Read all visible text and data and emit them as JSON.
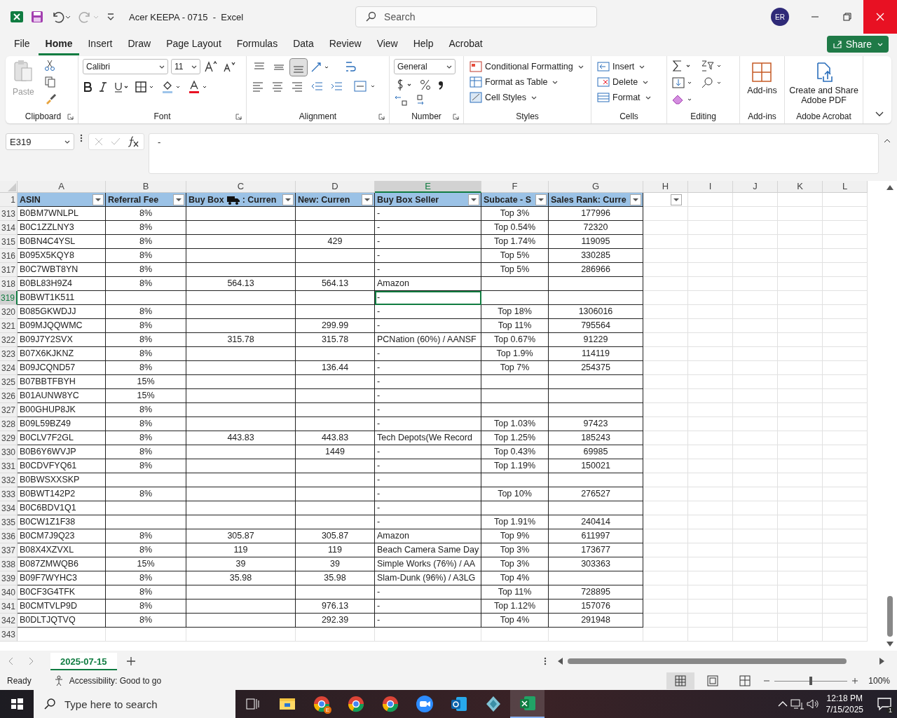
{
  "title_bar": {
    "title": "Acer KEEPA - 0715  -  Excel",
    "search_placeholder": "Search",
    "avatar_initials": "ER"
  },
  "menu_tabs": [
    {
      "label": "File",
      "selected": false
    },
    {
      "label": "Home",
      "selected": true
    },
    {
      "label": "Insert",
      "selected": false
    },
    {
      "label": "Draw",
      "selected": false
    },
    {
      "label": "Page Layout",
      "selected": false
    },
    {
      "label": "Formulas",
      "selected": false
    },
    {
      "label": "Data",
      "selected": false
    },
    {
      "label": "Review",
      "selected": false
    },
    {
      "label": "View",
      "selected": false
    },
    {
      "label": "Help",
      "selected": false
    },
    {
      "label": "Acrobat",
      "selected": false
    }
  ],
  "share_button": "Share",
  "ribbon": {
    "paste_label": "Paste",
    "font_name": "Calibri",
    "font_size": "11",
    "number_format": "General",
    "vertical_align": [
      {
        "kind": "top",
        "selected": false
      },
      {
        "kind": "middle",
        "selected": false
      },
      {
        "kind": "bottom",
        "selected": true
      }
    ],
    "styles": [
      {
        "kind": "conditional",
        "label": "Conditional Formatting"
      },
      {
        "kind": "table",
        "label": "Format as Table"
      },
      {
        "kind": "cellstyles",
        "label": "Cell Styles"
      }
    ],
    "cells": [
      {
        "kind": "insert",
        "label": "Insert"
      },
      {
        "kind": "delete",
        "label": "Delete"
      },
      {
        "kind": "format",
        "label": "Format"
      }
    ],
    "addins_button": "Add-ins",
    "adobe_button": "Create and Share Adobe PDF",
    "group_labels": [
      "Clipboard",
      "Font",
      "Alignment",
      "Number",
      "Styles",
      "Cells",
      "Editing",
      "Add-ins",
      "Adobe Acrobat"
    ]
  },
  "formula_bar": {
    "name_box": "E319",
    "formula": "-"
  },
  "columns": [
    {
      "letter": "A",
      "header": "ASIN",
      "selected": false
    },
    {
      "letter": "B",
      "header": "Referral Fee",
      "selected": false
    },
    {
      "letter": "C",
      "header": "Buy Box",
      "header_suffix": ": Curren",
      "selected": false
    },
    {
      "letter": "D",
      "header": "New: Curren",
      "selected": false
    },
    {
      "letter": "E",
      "header": "Buy Box Seller",
      "selected": true
    },
    {
      "letter": "F",
      "header": "Subcate - S",
      "selected": false
    },
    {
      "letter": "G",
      "header": "Sales Rank: Curre",
      "selected": false
    }
  ],
  "extra_columns": [
    {
      "letter": "H",
      "filter_button": true
    },
    {
      "letter": "I",
      "filter_button": false
    },
    {
      "letter": "J",
      "filter_button": false
    },
    {
      "letter": "K",
      "filter_button": false
    },
    {
      "letter": "L",
      "filter_button": false
    }
  ],
  "header_row": "1",
  "rows": [
    {
      "row": "313",
      "asin": "B0BM7WNLPL",
      "fee": "8%",
      "seller": "-",
      "subcat": "Top 3%",
      "rank": "177996",
      "selected": false
    },
    {
      "row": "314",
      "asin": "B0C1ZZLNY3",
      "fee": "8%",
      "seller": "-",
      "subcat": "Top 0.54%",
      "rank": "72320",
      "selected": false
    },
    {
      "row": "315",
      "asin": "B0BN4C4YSL",
      "fee": "8%",
      "new": "429",
      "seller": "-",
      "subcat": "Top 1.74%",
      "rank": "119095",
      "selected": false
    },
    {
      "row": "316",
      "asin": "B095X5KQY8",
      "fee": "8%",
      "seller": "-",
      "subcat": "Top 5%",
      "rank": "330285",
      "selected": false
    },
    {
      "row": "317",
      "asin": "B0C7WBT8YN",
      "fee": "8%",
      "seller": "-",
      "subcat": "Top 5%",
      "rank": "286966",
      "selected": false
    },
    {
      "row": "318",
      "asin": "B0BL83H9Z4",
      "fee": "8%",
      "buybox": "564.13",
      "new": "564.13",
      "seller": "Amazon",
      "selected": false
    },
    {
      "row": "319",
      "asin": "B0BWT1K511",
      "seller": "-",
      "selected": true
    },
    {
      "row": "320",
      "asin": "B085GKWDJJ",
      "fee": "8%",
      "seller": "-",
      "subcat": "Top 18%",
      "rank": "1306016",
      "selected": false
    },
    {
      "row": "321",
      "asin": "B09MJQQWMC",
      "fee": "8%",
      "new": "299.99",
      "seller": "-",
      "subcat": "Top 11%",
      "rank": "795564",
      "selected": false
    },
    {
      "row": "322",
      "asin": "B09J7Y2SVX",
      "fee": "8%",
      "buybox": "315.78",
      "new": "315.78",
      "seller": "PCNation (60%) / AANSF",
      "subcat": "Top 0.67%",
      "rank": "91229",
      "selected": false
    },
    {
      "row": "323",
      "asin": "B07X6KJKNZ",
      "fee": "8%",
      "seller": "-",
      "subcat": "Top 1.9%",
      "rank": "114119",
      "selected": false
    },
    {
      "row": "324",
      "asin": "B09JCQND57",
      "fee": "8%",
      "new": "136.44",
      "seller": "-",
      "subcat": "Top 7%",
      "rank": "254375",
      "selected": false
    },
    {
      "row": "325",
      "asin": "B07BBTFBYH",
      "fee": "15%",
      "seller": "-",
      "selected": false
    },
    {
      "row": "326",
      "asin": "B01AUNW8YC",
      "fee": "15%",
      "seller": "-",
      "selected": false
    },
    {
      "row": "327",
      "asin": "B00GHUP8JK",
      "fee": "8%",
      "seller": "-",
      "selected": false
    },
    {
      "row": "328",
      "asin": "B09L59BZ49",
      "fee": "8%",
      "seller": "-",
      "subcat": "Top 1.03%",
      "rank": "97423",
      "selected": false
    },
    {
      "row": "329",
      "asin": "B0CLV7F2GL",
      "fee": "8%",
      "buybox": "443.83",
      "new": "443.83",
      "seller": "Tech Depots(We Record",
      "subcat": "Top 1.25%",
      "rank": "185243",
      "selected": false
    },
    {
      "row": "330",
      "asin": "B0B6Y6WVJP",
      "fee": "8%",
      "new": "1449",
      "seller": "-",
      "subcat": "Top 0.43%",
      "rank": "69985",
      "selected": false
    },
    {
      "row": "331",
      "asin": "B0CDVFYQ61",
      "fee": "8%",
      "seller": "-",
      "subcat": "Top 1.19%",
      "rank": "150021",
      "selected": false
    },
    {
      "row": "332",
      "asin": "B0BWSXXSKP",
      "seller": "-",
      "selected": false
    },
    {
      "row": "333",
      "asin": "B0BWT142P2",
      "fee": "8%",
      "seller": "-",
      "subcat": "Top 10%",
      "rank": "276527",
      "selected": false
    },
    {
      "row": "334",
      "asin": "B0C6BDV1Q1",
      "seller": "-",
      "selected": false
    },
    {
      "row": "335",
      "asin": "B0CW1Z1F38",
      "seller": "-",
      "subcat": "Top 1.91%",
      "rank": "240414",
      "selected": false
    },
    {
      "row": "336",
      "asin": "B0CM7J9Q23",
      "fee": "8%",
      "buybox": "305.87",
      "new": "305.87",
      "seller": "Amazon",
      "subcat": "Top 9%",
      "rank": "611997",
      "selected": false
    },
    {
      "row": "337",
      "asin": "B08X4XZVXL",
      "fee": "8%",
      "buybox": "119",
      "new": "119",
      "seller": "Beach Camera Same Day",
      "subcat": "Top 3%",
      "rank": "173677",
      "selected": false
    },
    {
      "row": "338",
      "asin": "B087ZMWQB6",
      "fee": "15%",
      "buybox": "39",
      "new": "39",
      "seller": "Simple Works (76%) / AA",
      "subcat": "Top 3%",
      "rank": "303363",
      "selected": false
    },
    {
      "row": "339",
      "asin": "B09F7WYHC3",
      "fee": "8%",
      "buybox": "35.98",
      "new": "35.98",
      "seller": "Slam-Dunk (96%) / A3LG",
      "subcat": "Top 4%",
      "selected": false
    },
    {
      "row": "340",
      "asin": "B0CF3G4TFK",
      "fee": "8%",
      "seller": "-",
      "subcat": "Top 11%",
      "rank": "728895",
      "selected": false
    },
    {
      "row": "341",
      "asin": "B0CMTVLP9D",
      "fee": "8%",
      "new": "976.13",
      "seller": "-",
      "subcat": "Top 1.12%",
      "rank": "157076",
      "selected": false
    },
    {
      "row": "342",
      "asin": "B0DLTJQTVQ",
      "fee": "8%",
      "new": "292.39",
      "seller": "-",
      "subcat": "Top 4%",
      "rank": "291948",
      "selected": false
    }
  ],
  "empty_rows": [
    "343"
  ],
  "sheet_tabs": [
    {
      "label": "2025-07-15",
      "selected": true
    }
  ],
  "status_bar": {
    "status": "Ready",
    "accessibility": "Accessibility: Good to go",
    "zoom": {
      "level": 0.5,
      "reading": "100%"
    },
    "views": [
      {
        "kind": "normal",
        "selected": true
      },
      {
        "kind": "page-layout",
        "selected": false
      },
      {
        "kind": "page-break",
        "selected": false
      }
    ]
  },
  "taskbar": {
    "search_placeholder": "Type here to search",
    "time": "12:18 PM",
    "date": "7/15/2025",
    "notifications": "1",
    "apps": [
      {
        "kind": "taskview",
        "selected": false
      },
      {
        "kind": "files",
        "selected": false
      },
      {
        "kind": "browser",
        "badge": "E",
        "selected": false
      },
      {
        "kind": "browser",
        "selected": false
      },
      {
        "kind": "browser",
        "selected": false
      },
      {
        "kind": "meeting",
        "selected": false
      },
      {
        "kind": "mail",
        "selected": false
      },
      {
        "kind": "diamond",
        "selected": false
      },
      {
        "kind": "sheet",
        "selected": true
      }
    ]
  }
}
